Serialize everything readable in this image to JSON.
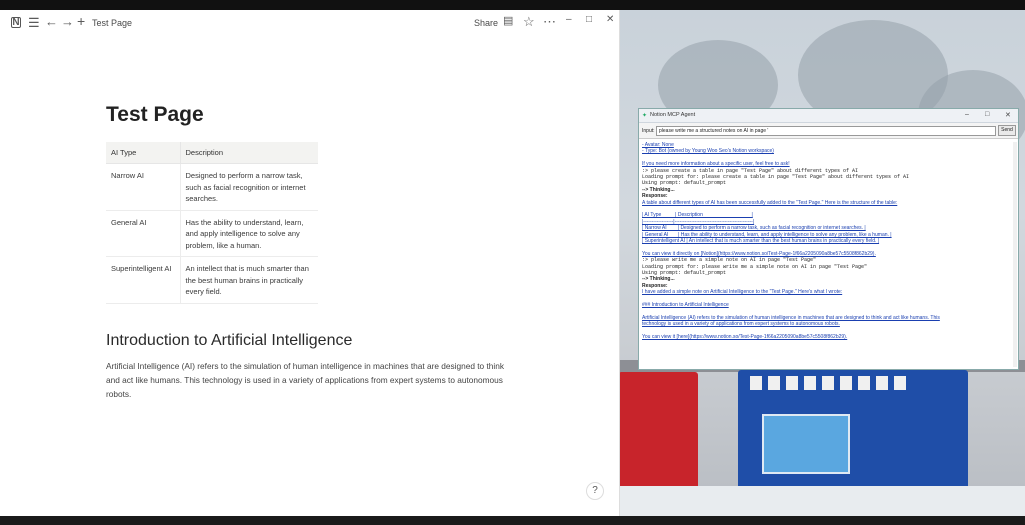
{
  "notion": {
    "breadcrumb": "Test Page",
    "share_label": "Share",
    "page_title": "Test Page",
    "table": {
      "headers": [
        "AI Type",
        "Description"
      ],
      "rows": [
        {
          "type": "Narrow AI",
          "description": "Designed to perform a narrow task, such as facial recognition or internet searches."
        },
        {
          "type": "General AI",
          "description": "Has the ability to understand, learn, and apply intelligence to solve any problem, like a human."
        },
        {
          "type": "Superintelligent AI",
          "description": "An intellect that is much smarter than the best human brains in practically every field."
        }
      ]
    },
    "heading": "Introduction to Artificial Intelligence",
    "paragraph": "Artificial Intelligence (AI) refers to the simulation of human intelligence in machines that are designed to think and act like humans. This technology is used in a variety of applications from expert systems to autonomous robots.",
    "help_label": "?"
  },
  "agent": {
    "title": "Notion MCP Agent",
    "input_label": "Input:",
    "input_value": "please write me a structured notes on AI in page '",
    "send_label": "Send",
    "log": [
      {
        "text": "- Avatar: None",
        "style": "link"
      },
      {
        "text": "- Type: Bot (owned by Young Woo Seo's Notion workspace)",
        "style": "link"
      },
      {
        "text": "",
        "style": ""
      },
      {
        "text": "If you need more information about a specific user, feel free to ask!",
        "style": "link"
      },
      {
        "text": ":> please create a table in page \"Test Page\" about different types of AI",
        "style": "mono"
      },
      {
        "text": "Loading prompt for: please create a table in page \"Test Page\" about different types of AI",
        "style": "mono"
      },
      {
        "text": "Using prompt: default_prompt",
        "style": "mono"
      },
      {
        "text": "--> Thinking...",
        "style": "bold"
      },
      {
        "text": "Response:",
        "style": "bold"
      },
      {
        "text": "A table about different types of AI has been successfully added to the \"Test Page.\" Here is the structure of the table:",
        "style": "link"
      },
      {
        "text": "",
        "style": ""
      },
      {
        "text": "| AI Type          | Description                                   |",
        "style": "link"
      },
      {
        "text": "|------------------|-----------------------------------------------|",
        "style": "link"
      },
      {
        "text": "| Narrow AI        | Designed to perform a narrow task, such as facial recognition or internet searches. |",
        "style": "link"
      },
      {
        "text": "| General AI       | Has the ability to understand, learn, and apply intelligence to solve any problem, like a human. |",
        "style": "link"
      },
      {
        "text": "| Superintelligent AI | An intellect that is much smarter than the best human brains in practically every field. |",
        "style": "link"
      },
      {
        "text": "",
        "style": ""
      },
      {
        "text": "You can view it directly on [Notion](https://www.notion.so/Test-Page-1f66a2205090a8be57c5508f862b29).",
        "style": "link"
      },
      {
        "text": ":> please write me a simple note on AI in page \"Test Page\"",
        "style": "mono"
      },
      {
        "text": "Loading prompt for: please write me a simple note on AI in page \"Test Page\"",
        "style": "mono"
      },
      {
        "text": "Using prompt: default_prompt",
        "style": "mono"
      },
      {
        "text": "--> Thinking...",
        "style": "bold"
      },
      {
        "text": "Response:",
        "style": "bold"
      },
      {
        "text": "I have added a simple note on Artificial Intelligence to the \"Test Page.\" Here's what I wrote:",
        "style": "link"
      },
      {
        "text": "",
        "style": ""
      },
      {
        "text": "### Introduction to Artificial Intelligence",
        "style": "link"
      },
      {
        "text": "",
        "style": ""
      },
      {
        "text": "Artificial Intelligence (AI) refers to the simulation of human intelligence in machines that are designed to think and act like humans. This",
        "style": "link"
      },
      {
        "text": "technology is used in a variety of applications from expert systems to autonomous robots.",
        "style": "link"
      },
      {
        "text": "",
        "style": ""
      },
      {
        "text": "You can view it [here](https://www.notion.so/Test-Page-1f66a2205090a8be57c5508f862b29).",
        "style": "link"
      }
    ]
  },
  "icons": {
    "notion_logo": "notion-logo-icon",
    "menu": "menu-icon",
    "back": "arrow-left-icon",
    "forward": "arrow-right-icon",
    "add": "plus-icon",
    "comment": "comment-icon",
    "favorite": "star-icon",
    "more": "more-icon",
    "minimize": "minimize-icon",
    "maximize": "maximize-icon",
    "close": "close-icon"
  },
  "colors": {
    "link": "#1a3fb0",
    "notion_bg": "#ffffff",
    "table_header_bg": "#f3f3f1"
  }
}
